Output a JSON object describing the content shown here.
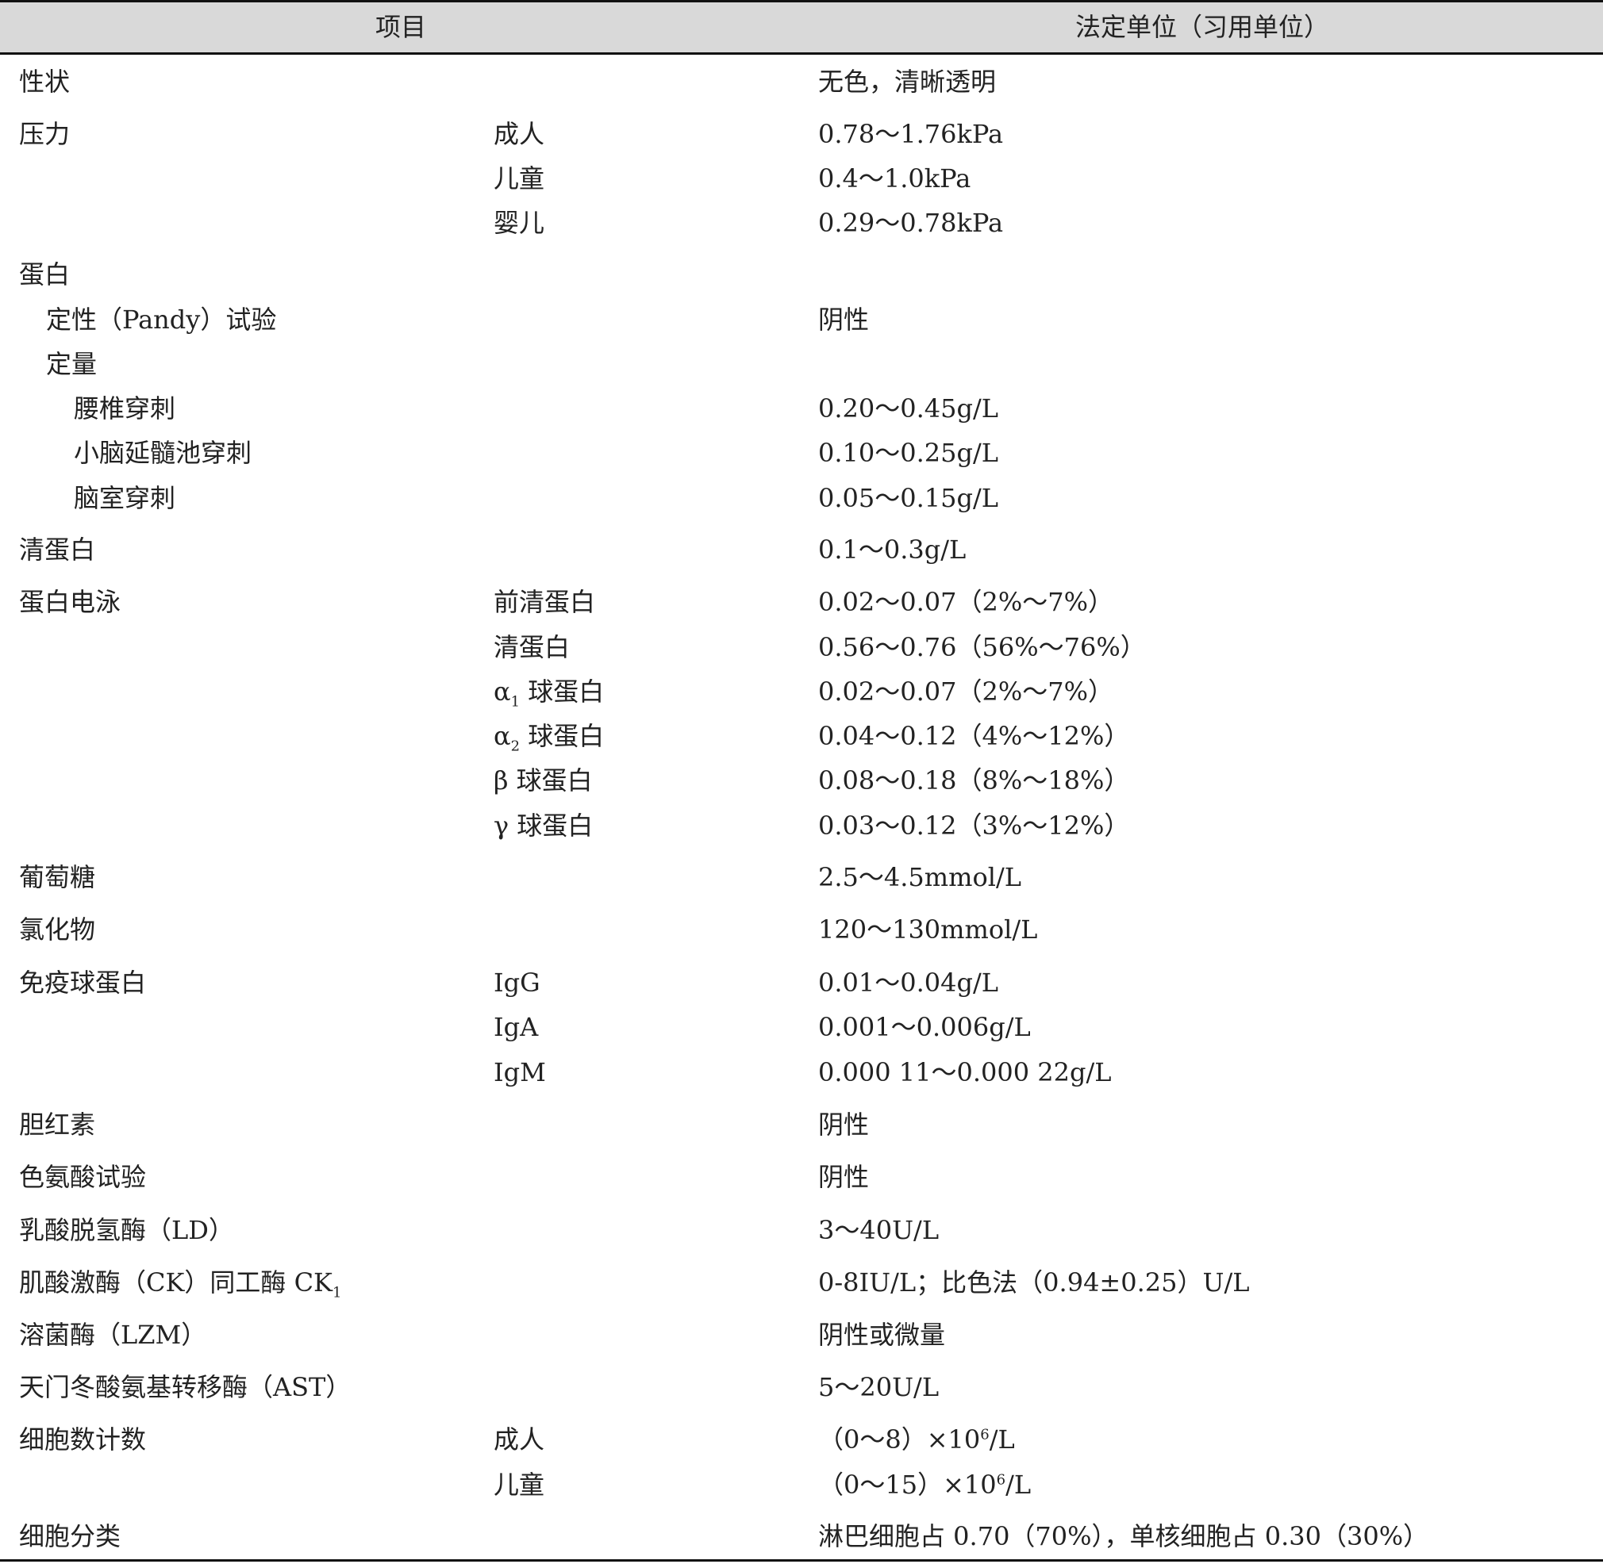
{
  "header": {
    "item": "项目",
    "unit": "法定单位（习用单位）"
  },
  "rows": [
    {
      "item": "性状",
      "sub": "",
      "value": "无色，清晰透明"
    },
    {
      "item": "压力",
      "sub": "成人",
      "value": "0.78～1.76kPa"
    },
    {
      "item": "",
      "sub": "儿童",
      "value": "0.4～1.0kPa"
    },
    {
      "item": "",
      "sub": "婴儿",
      "value": "0.29～0.78kPa"
    },
    {
      "item": "蛋白",
      "sub": "",
      "value": ""
    },
    {
      "item": "定性（Pandy）试验",
      "sub": "",
      "value": "阴性"
    },
    {
      "item": "定量",
      "sub": "",
      "value": ""
    },
    {
      "item": "腰椎穿刺",
      "sub": "",
      "value": "0.20～0.45g/L"
    },
    {
      "item": "小脑延髓池穿刺",
      "sub": "",
      "value": "0.10～0.25g/L"
    },
    {
      "item": "脑室穿刺",
      "sub": "",
      "value": "0.05～0.15g/L"
    },
    {
      "item": "清蛋白",
      "sub": "",
      "value": "0.1～0.3g/L"
    },
    {
      "item": "蛋白电泳",
      "sub": "前清蛋白",
      "value": "0.02～0.07（2%～7%）"
    },
    {
      "item": "",
      "sub": "清蛋白",
      "value": "0.56～0.76（56%～76%）"
    },
    {
      "item": "",
      "sub_prefix": "α",
      "sub_subscript": "1",
      "sub": " 球蛋白",
      "value": "0.02～0.07（2%～7%）"
    },
    {
      "item": "",
      "sub_prefix": "α",
      "sub_subscript": "2",
      "sub": " 球蛋白",
      "value": "0.04～0.12（4%～12%）"
    },
    {
      "item": "",
      "sub": "β 球蛋白",
      "value": "0.08～0.18（8%～18%）"
    },
    {
      "item": "",
      "sub": "γ 球蛋白",
      "value": "0.03～0.12（3%～12%）"
    },
    {
      "item": "葡萄糖",
      "sub": "",
      "value": "2.5～4.5mmol/L"
    },
    {
      "item": "氯化物",
      "sub": "",
      "value": "120～130mmol/L"
    },
    {
      "item": "免疫球蛋白",
      "sub": "IgG",
      "value": "0.01～0.04g/L"
    },
    {
      "item": "",
      "sub": "IgA",
      "value": "0.001～0.006g/L"
    },
    {
      "item": "",
      "sub": "IgM",
      "value": "0.000 11～0.000 22g/L"
    },
    {
      "item": "胆红素",
      "sub": "",
      "value": "阴性"
    },
    {
      "item": "色氨酸试验",
      "sub": "",
      "value": "阴性"
    },
    {
      "item": "乳酸脱氢酶（LD）",
      "sub": "",
      "value": "3～40U/L"
    },
    {
      "item": "肌酸激酶（CK）同工酶 CK",
      "item_subscript": "1",
      "sub": "",
      "value": "0-8IU/L；比色法（0.94±0.25）U/L"
    },
    {
      "item": "溶菌酶（LZM）",
      "sub": "",
      "value": "阴性或微量"
    },
    {
      "item": "天门冬酸氨基转移酶（AST）",
      "sub": "",
      "value": "5～20U/L"
    },
    {
      "item": "细胞数计数",
      "sub": "成人",
      "value_main": "（0～8）×10",
      "value_sup": "6",
      "value_tail": "/L"
    },
    {
      "item": "",
      "sub": "儿童",
      "value_main": "（0～15）×10",
      "value_sup": "6",
      "value_tail": "/L"
    },
    {
      "item": "细胞分类",
      "sub": "",
      "value": "淋巴细胞占 0.70（70%），单核细胞占 0.30（30%）"
    }
  ]
}
